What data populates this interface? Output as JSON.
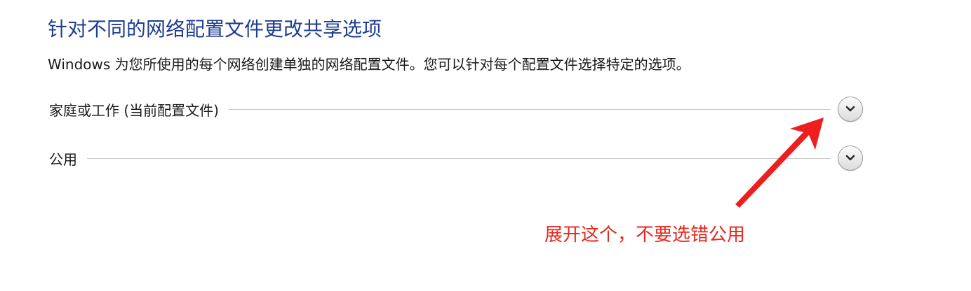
{
  "page": {
    "title": "针对不同的网络配置文件更改共享选项",
    "description": "Windows 为您所使用的每个网络创建单独的网络配置文件。您可以针对每个配置文件选择特定的选项。"
  },
  "profiles": [
    {
      "label": "家庭或工作 (当前配置文件)",
      "expand_icon": "chevron-down-icon"
    },
    {
      "label": "公用",
      "expand_icon": "chevron-down-icon"
    }
  ],
  "annotation": {
    "text": "展开这个，不要选错公用",
    "color": "#e8281c"
  },
  "colors": {
    "title": "#1e3d8f",
    "text": "#1a1a1a",
    "divider": "#c8c8c8"
  }
}
